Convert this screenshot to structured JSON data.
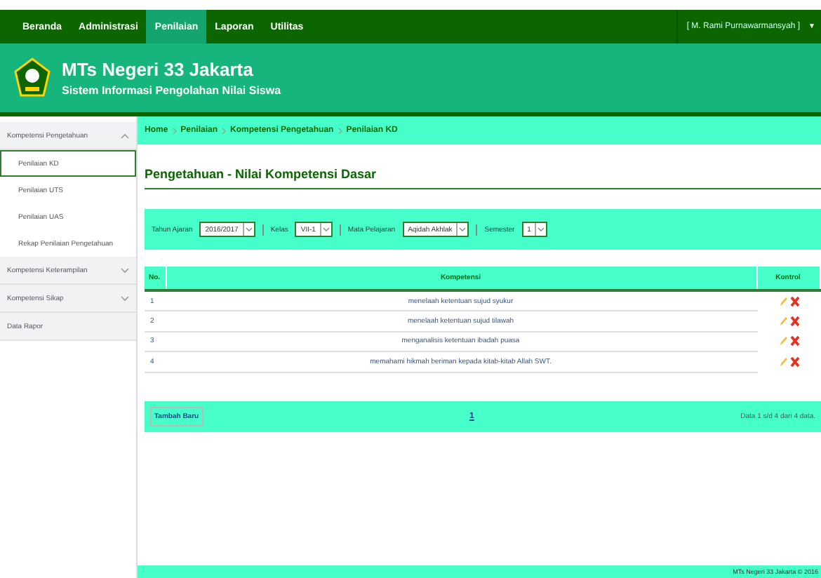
{
  "nav": {
    "items": [
      {
        "label": "Beranda",
        "selected": false
      },
      {
        "label": "Administrasi",
        "selected": false
      },
      {
        "label": "Penilaian",
        "selected": true
      },
      {
        "label": "Laporan",
        "selected": false
      },
      {
        "label": "Utilitas",
        "selected": false
      }
    ],
    "user": "[ M. Rami Purnawarmansyah ]",
    "user_caret": "▼"
  },
  "header": {
    "title": "MTs Negeri 33 Jakarta",
    "subtitle": "Sistem Informasi Pengolahan Nilai Siswa"
  },
  "sidebar": {
    "items": [
      {
        "label": "Kompetensi Pengetahuan",
        "expanded": true,
        "children": [
          {
            "label": "Penilaian KD",
            "selected": true
          },
          {
            "label": "Penilaian UTS",
            "selected": false
          },
          {
            "label": "Penilaian UAS",
            "selected": false
          },
          {
            "label": "Rekap Penilaian Pengetahuan",
            "selected": false
          }
        ]
      },
      {
        "label": "Kompetensi Keterampilan",
        "expanded": false
      },
      {
        "label": "Kompetensi Sikap",
        "expanded": false
      },
      {
        "label": "Data Rapor"
      }
    ]
  },
  "breadcrumb": [
    "Home",
    "Penilaian",
    "Kompetensi Pengetahuan",
    "Penilaian KD"
  ],
  "page_title": "Pengetahuan - Nilai Kompetensi Dasar",
  "filters": [
    {
      "label": "Tahun Ajaran",
      "value": "2016/2017"
    },
    {
      "label": "Kelas",
      "value": "VII-1"
    },
    {
      "label": "Mata Pelajaran",
      "value": "Aqidah Akhlak"
    },
    {
      "label": "Semester",
      "value": "1"
    }
  ],
  "table": {
    "columns": [
      "No.",
      "Kompetensi",
      "Kontrol"
    ],
    "rows": [
      {
        "no": "1",
        "kompetensi": "menelaah ketentuan sujud syukur"
      },
      {
        "no": "2",
        "kompetensi": "menelaah ketentuan sujud tilawah"
      },
      {
        "no": "3",
        "kompetensi": "menganalisis ketentuan ibadah puasa"
      },
      {
        "no": "4",
        "kompetensi": "memahami hikmah beriman kepada kitab-kitab Allah SWT."
      }
    ]
  },
  "pager": {
    "add_button": "Tambah Baru",
    "page": "1",
    "summary": "Data 1 s/d 4 dari 4 data."
  },
  "footer": "MTs Negeri 33 Jakarta © 2016"
}
